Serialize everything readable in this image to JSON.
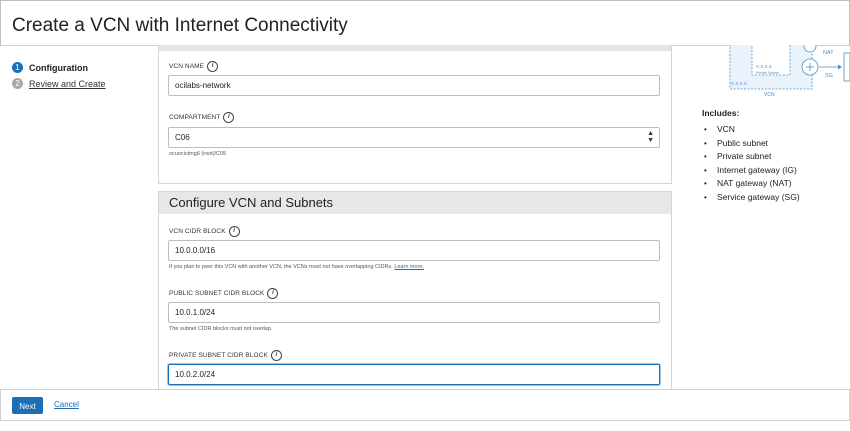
{
  "header": {
    "title": "Create a VCN with Internet Connectivity"
  },
  "steps": [
    {
      "num": "1",
      "label": "Configuration"
    },
    {
      "num": "2",
      "label": "Review and Create"
    }
  ],
  "basic": {
    "vcn_name_label": "VCN NAME",
    "vcn_name_value": "ocilabs-network",
    "compartment_label": "COMPARTMENT",
    "compartment_value": "C06",
    "compartment_path": "ocuocictmg6 (root)/C05"
  },
  "subnets": {
    "title": "Configure VCN and Subnets",
    "vcn_cidr_label": "VCN CIDR BLOCK",
    "vcn_cidr_value": "10.0.0.0/16",
    "vcn_cidr_help": "If you plan to peer this VCN with another VCN, the VCNs must not have overlapping CIDRs.",
    "learn_more": "Learn more.",
    "public_cidr_label": "PUBLIC SUBNET CIDR BLOCK",
    "public_cidr_value": "10.0.1.0/24",
    "public_cidr_help": "The subnet CIDR blocks must not overlap.",
    "private_cidr_label": "PRIVATE SUBNET CIDR BLOCK",
    "private_cidr_value": "10.0.2.0/24"
  },
  "diagram": {
    "nat": "NAT",
    "sg": "SG",
    "vcn": "VCN",
    "private_subnet": "Private Subnet",
    "ip1": "X.X.X.X",
    "ip2": "X.X.X.X"
  },
  "includes": {
    "title": "Includes:",
    "items": [
      "VCN",
      "Public subnet",
      "Private subnet",
      "Internet gateway (IG)",
      "NAT gateway (NAT)",
      "Service gateway (SG)"
    ]
  },
  "footer": {
    "next": "Next",
    "cancel": "Cancel"
  },
  "colors": {
    "accent": "#1b6fb5",
    "diagram": "#4a90c8"
  }
}
